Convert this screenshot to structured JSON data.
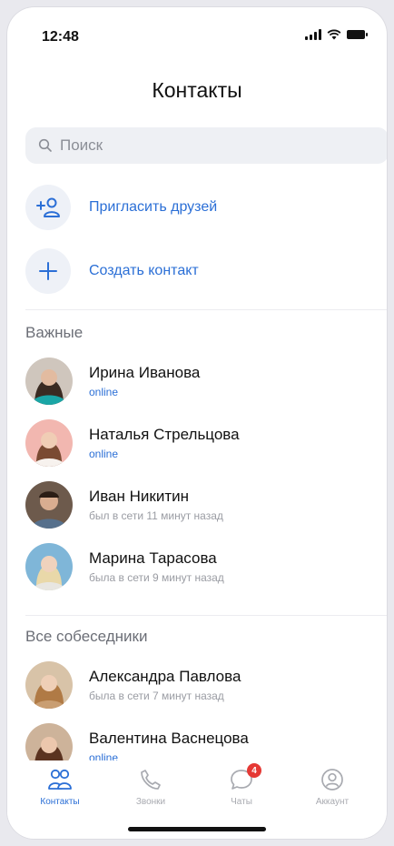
{
  "status_bar": {
    "time": "12:48"
  },
  "header": {
    "title": "Контакты"
  },
  "search": {
    "placeholder": "Поиск"
  },
  "actions": [
    {
      "label": "Пригласить друзей",
      "icon": "add-user-icon"
    },
    {
      "label": "Создать контакт",
      "icon": "plus-icon"
    }
  ],
  "sections": {
    "important": {
      "title": "Важные",
      "contacts": [
        {
          "name": "Ирина Иванова",
          "status": "online"
        },
        {
          "name": "Наталья Стрельцова",
          "status": "online"
        },
        {
          "name": "Иван Никитин",
          "status": "был в сети 11 минут назад"
        },
        {
          "name": "Марина Тарасова",
          "status": "была в сети 9 минут назад"
        }
      ]
    },
    "all": {
      "title": "Все собеседники",
      "contacts": [
        {
          "name": "Александра Павлова",
          "status": "была в сети 7 минут назад"
        },
        {
          "name": "Валентина Васнецова",
          "status": "online"
        }
      ]
    }
  },
  "tabbar": {
    "tabs": [
      {
        "label": "Контакты",
        "icon": "contacts-icon",
        "active": true
      },
      {
        "label": "Звонки",
        "icon": "phone-icon",
        "active": false
      },
      {
        "label": "Чаты",
        "icon": "chat-icon",
        "active": false,
        "badge": "4"
      },
      {
        "label": "Аккаунт",
        "icon": "account-icon",
        "active": false
      }
    ]
  },
  "colors": {
    "accent": "#2b6fd6",
    "badge": "#e53935"
  }
}
